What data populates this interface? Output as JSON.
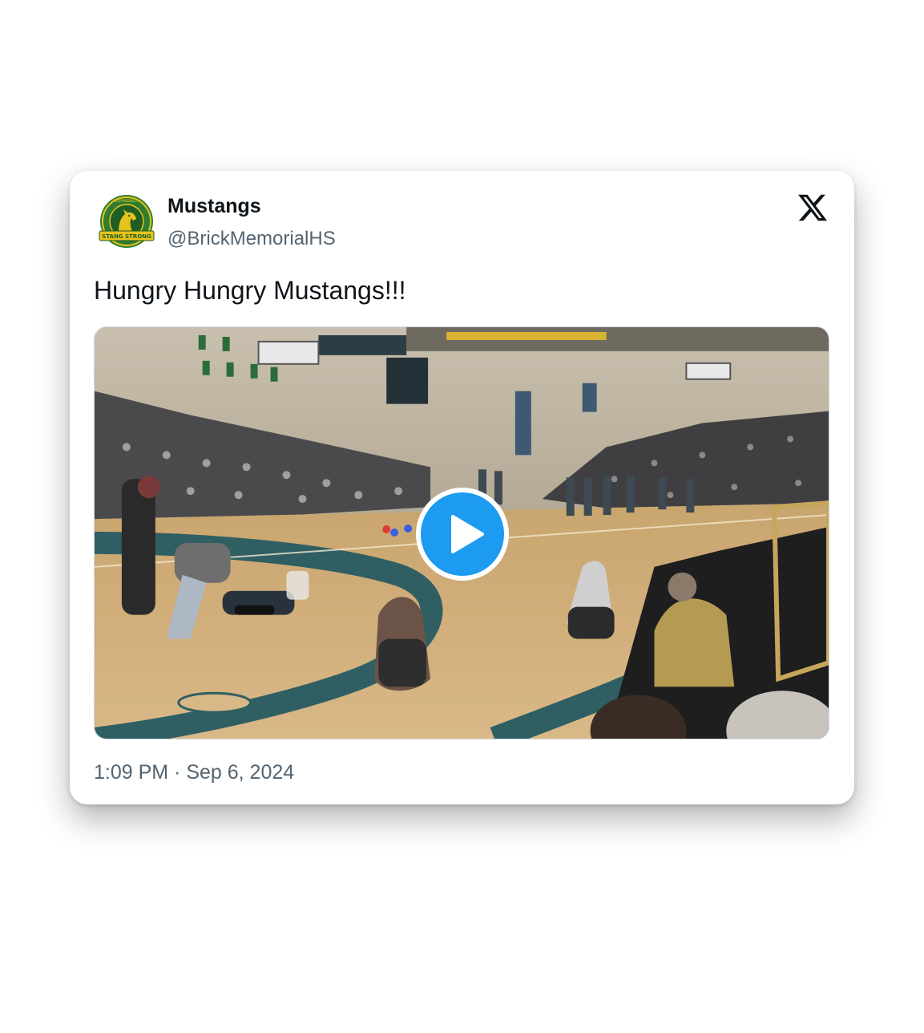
{
  "tweet": {
    "author_name": "Mustangs",
    "author_handle": "@BrickMemorialHS",
    "text": "Hungry Hungry Mustangs!!!",
    "time": "1:09 PM",
    "separator": " · ",
    "date": "Sep 6, 2024"
  },
  "avatar": {
    "logo_ring_text": "RESPONSIBILITY INTEGRITY RESPECT",
    "logo_banner_text": "STANG STRONG",
    "colors": {
      "green": "#2f7d32",
      "gold": "#e8c21c"
    }
  },
  "media": {
    "type": "video",
    "play_icon": "play-icon",
    "accent": "#1d9bf0"
  },
  "brand": {
    "logo_icon": "x-logo-icon"
  }
}
